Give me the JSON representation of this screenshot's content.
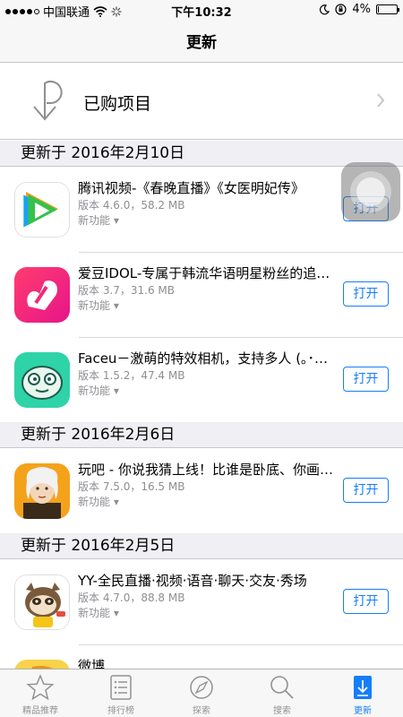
{
  "status_bar": {
    "carrier": "中国联通",
    "time": "下午10:32",
    "battery_percent": "4%",
    "battery_level": 0.04
  },
  "nav": {
    "title": "更新"
  },
  "purchased": {
    "label": "已购项目"
  },
  "sections": [
    {
      "header": "更新于 2016年2月10日",
      "apps": [
        {
          "name": "腾讯视频-《春晚直播》《女医明妃传》",
          "meta": "版本 4.6.0，58.2 MB",
          "new_features": "新功能 ▾",
          "button": "打开",
          "icon": "tencent-video-icon"
        },
        {
          "name": "爱豆IDOL-专属于韩流华语明星粉丝的追星神器",
          "meta": "版本 3.7，31.6 MB",
          "new_features": "新功能 ▾",
          "button": "打开",
          "icon": "idol-icon"
        },
        {
          "name": "Faceu－激萌的特效相机，支持多人 (｡･ω･｡)",
          "meta": "版本 1.5.2，47.4 MB",
          "new_features": "新功能 ▾",
          "button": "打开",
          "icon": "faceu-icon"
        }
      ]
    },
    {
      "header": "更新于 2016年2月6日",
      "apps": [
        {
          "name": "玩吧 - 你说我猜上线！比谁是卧底、你画我猜",
          "meta": "版本 7.5.0，16.5 MB",
          "new_features": "新功能 ▾",
          "button": "打开",
          "icon": "wanba-icon"
        }
      ]
    },
    {
      "header": "更新于 2016年2月5日",
      "apps": [
        {
          "name": "YY-全民直播·视频·语音·聊天·交友·秀场",
          "meta": "版本 4.7.0，88.8 MB",
          "new_features": "新功能 ▾",
          "button": "打开",
          "icon": "yy-icon"
        },
        {
          "name": "微博",
          "meta": "",
          "new_features": "",
          "button": "",
          "icon": "weibo-icon"
        }
      ]
    }
  ],
  "tabs": [
    {
      "label": "精品推荐",
      "icon": "star-icon"
    },
    {
      "label": "排行榜",
      "icon": "list-icon"
    },
    {
      "label": "探索",
      "icon": "compass-icon"
    },
    {
      "label": "搜索",
      "icon": "search-icon"
    },
    {
      "label": "更新",
      "icon": "download-icon",
      "active": true
    }
  ],
  "colors": {
    "accent": "#157efb",
    "header_bg": "#efeff4",
    "tab_inactive": "#929292"
  }
}
